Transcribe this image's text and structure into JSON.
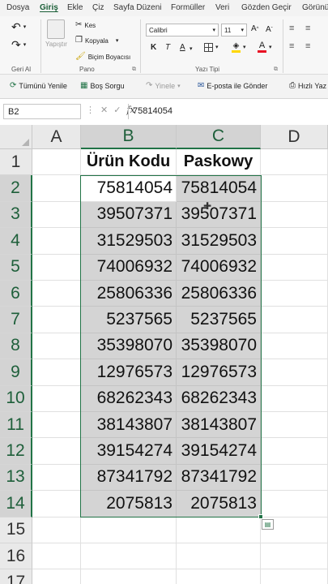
{
  "menu": {
    "tabs": [
      {
        "label": "Dosya",
        "active": false
      },
      {
        "label": "Giriş",
        "active": true
      },
      {
        "label": "Ekle",
        "active": false
      },
      {
        "label": "Çiz",
        "active": false
      },
      {
        "label": "Sayfa Düzeni",
        "active": false
      },
      {
        "label": "Formüller",
        "active": false
      },
      {
        "label": "Veri",
        "active": false
      },
      {
        "label": "Gözden Geçir",
        "active": false
      },
      {
        "label": "Görünüm",
        "active": false
      }
    ]
  },
  "ribbon": {
    "undo_group_label": "Geri Al",
    "clipboard": {
      "paste_label": "Yapıştır",
      "cut_label": "Kes",
      "copy_label": "Kopyala",
      "format_painter_label": "Biçim Boyacısı",
      "group_label": "Pano"
    },
    "font": {
      "font_name": "Calibri",
      "font_size": "11",
      "bold": "K",
      "italic": "T",
      "underline": "A",
      "group_label": "Yazı Tipi",
      "fill_color": "#ffd700",
      "font_color": "#e81123"
    }
  },
  "quickbar": {
    "refresh_all": "Tümünü Yenile",
    "empty_query": "Boş Sorgu",
    "redo": "Yinele",
    "email_send": "E-posta ile Gönder",
    "quick_print": "Hızlı Yaz"
  },
  "formula_bar": {
    "name_box": "B2",
    "formula": "75814054"
  },
  "sheet": {
    "columns": [
      "A",
      "B",
      "C",
      "D"
    ],
    "rows": [
      {
        "num": "1",
        "b": "Ürün Kodu",
        "c": "Paskowy"
      },
      {
        "num": "2",
        "b": "75814054",
        "c": "75814054"
      },
      {
        "num": "3",
        "b": "39507371",
        "c": "39507371"
      },
      {
        "num": "4",
        "b": "31529503",
        "c": "31529503"
      },
      {
        "num": "5",
        "b": "74006932",
        "c": "74006932"
      },
      {
        "num": "6",
        "b": "25806336",
        "c": "25806336"
      },
      {
        "num": "7",
        "b": "5237565",
        "c": "5237565"
      },
      {
        "num": "8",
        "b": "35398070",
        "c": "35398070"
      },
      {
        "num": "9",
        "b": "12976573",
        "c": "12976573"
      },
      {
        "num": "10",
        "b": "68262343",
        "c": "68262343"
      },
      {
        "num": "11",
        "b": "38143807",
        "c": "38143807"
      },
      {
        "num": "12",
        "b": "39154274",
        "c": "39154274"
      },
      {
        "num": "13",
        "b": "87341792",
        "c": "87341792"
      },
      {
        "num": "14",
        "b": "2075813",
        "c": "2075813"
      },
      {
        "num": "15",
        "b": "",
        "c": ""
      },
      {
        "num": "16",
        "b": "",
        "c": ""
      },
      {
        "num": "17",
        "b": "",
        "c": ""
      }
    ],
    "accent_color": "#217346"
  }
}
